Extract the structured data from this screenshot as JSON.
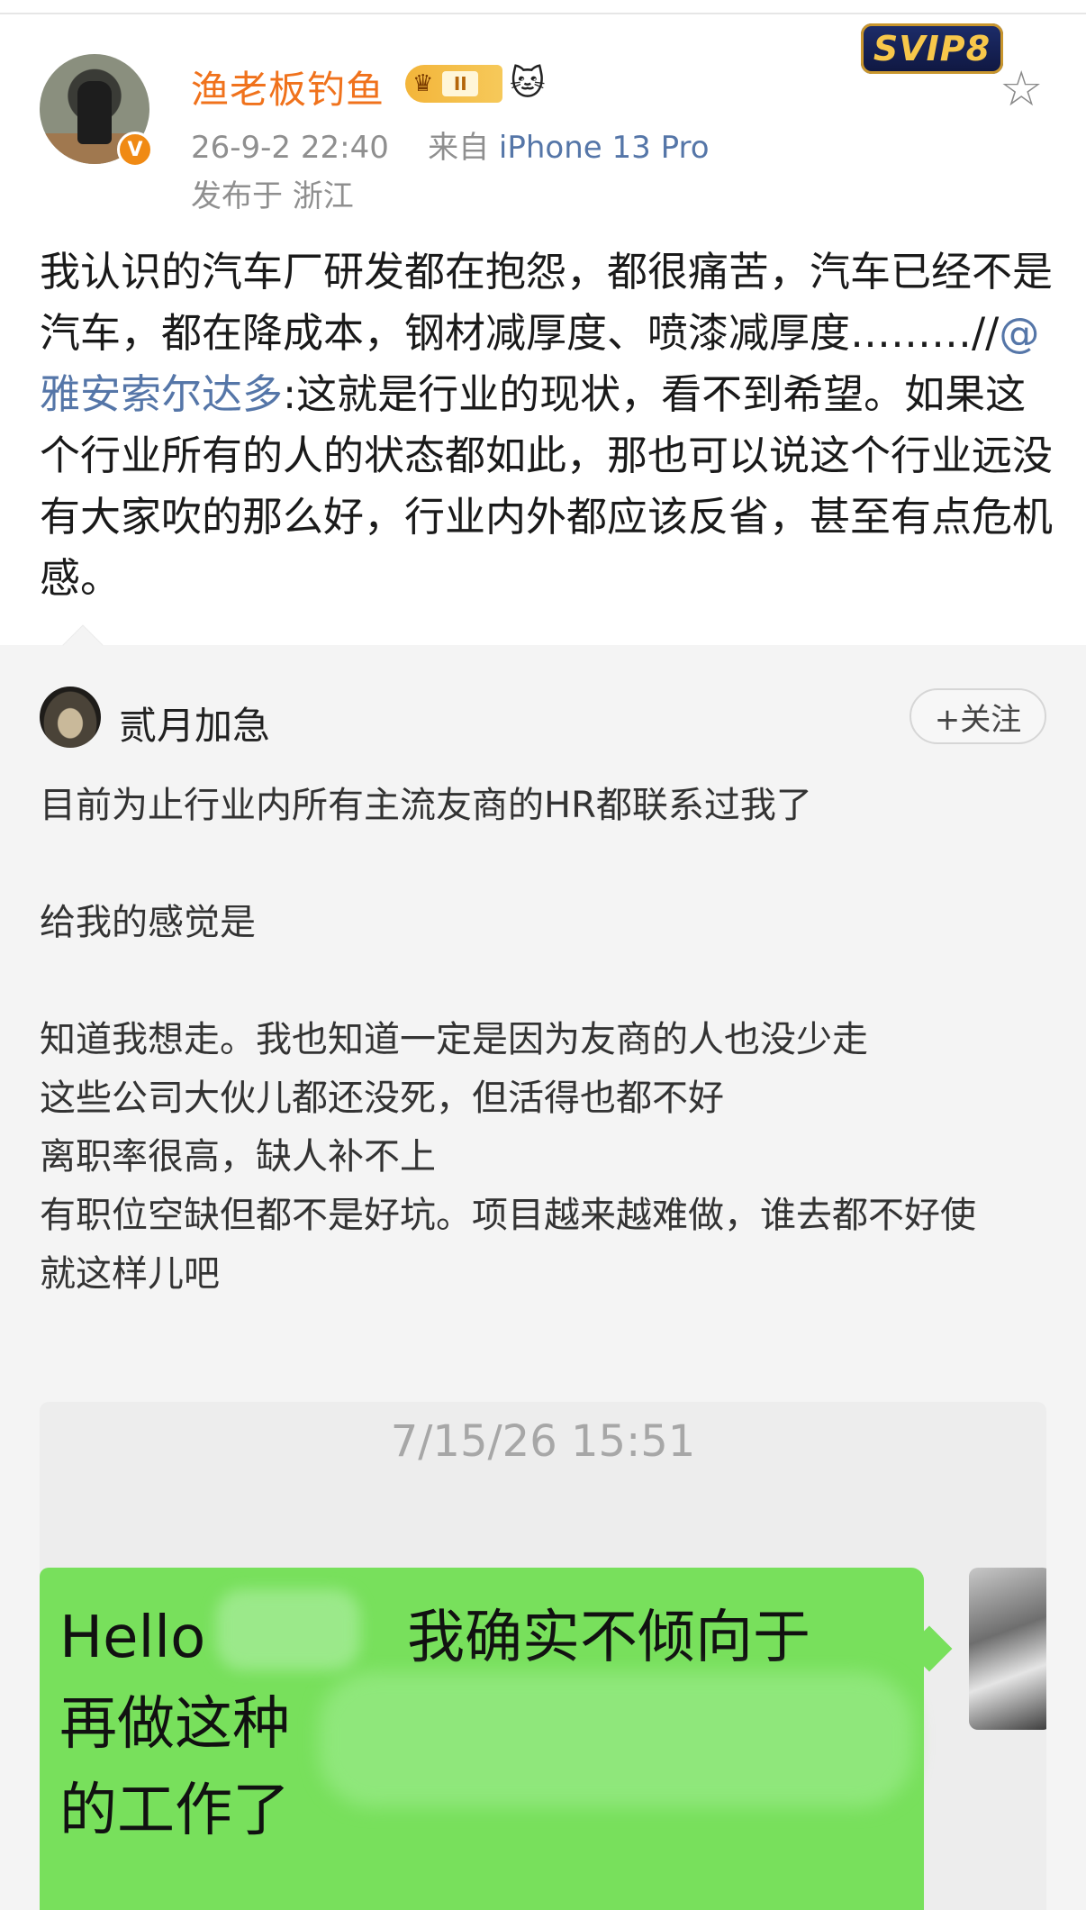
{
  "post": {
    "username": "渔老板钓鱼",
    "level_badge": "II",
    "vip_badge": "SVIP8",
    "verified_mark": "V",
    "timestamp": "26-9-2 22:40",
    "source_prefix": "来自",
    "source_device": "iPhone 13 Pro",
    "location": "发布于 浙江",
    "text_before_mention": "我认识的汽车厂研发都在抱怨，都很痛苦，汽车已经不是汽车，都在降成本，钢材减厚度、喷漆减厚度………//",
    "mention": "@雅安索尔达多",
    "text_after_mention": ":这就是行业的现状，看不到希望。如果这个行业所有的人的状态都如此，那也可以说这个行业远没有大家吹的那么好，行业内外都应该反省，甚至有点危机感。"
  },
  "repost": {
    "username": "贰月加急",
    "follow_label": "+关注",
    "lines": [
      "目前为止行业内所有主流友商的HR都联系过我了",
      "",
      "给我的感觉是",
      "",
      "知道我想走。我也知道一定是因为友商的人也没少走",
      "这些公司大伙儿都还没死，但活得也都不好",
      "离职率很高，缺人补不上",
      "有职位空缺但都不是好坑。项目越来越难做，谁去都不好使",
      "就这样儿吧"
    ],
    "chat": {
      "time": "7/15/26 15:51",
      "bubble_line1": "Hello           我确实不倾向于",
      "bubble_line2": "再做这种",
      "bubble_line3": "的工作了"
    }
  },
  "icons": {
    "favorite": "star-outline-icon",
    "level": "crown-icon",
    "emoji": "cat-emoji"
  }
}
